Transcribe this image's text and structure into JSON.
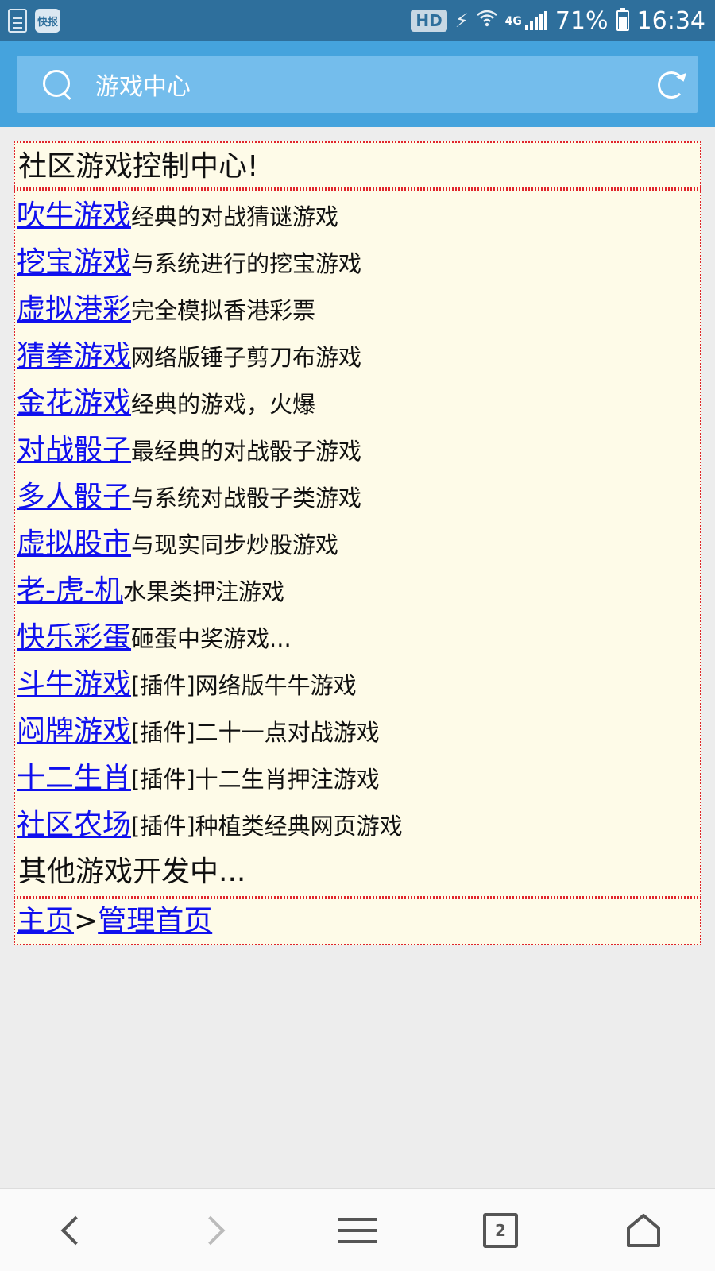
{
  "status_bar": {
    "app_badge": "快报",
    "hd": "HD",
    "network": "4G",
    "battery": "71%",
    "time": "16:34"
  },
  "address_bar": {
    "text": "游戏中心"
  },
  "page": {
    "title": "社区游戏控制中心!",
    "games": [
      {
        "name": "吹牛游戏",
        "desc": "经典的对战猜谜游戏"
      },
      {
        "name": "挖宝游戏",
        "desc": "与系统进行的挖宝游戏"
      },
      {
        "name": "虚拟港彩",
        "desc": "完全模拟香港彩票"
      },
      {
        "name": "猜拳游戏",
        "desc": "网络版锤子剪刀布游戏"
      },
      {
        "name": "金花游戏",
        "desc": "经典的游戏，火爆"
      },
      {
        "name": "对战骰子",
        "desc": "最经典的对战骰子游戏"
      },
      {
        "name": "多人骰子",
        "desc": "与系统对战骰子类游戏"
      },
      {
        "name": "虚拟股市",
        "desc": "与现实同步炒股游戏"
      },
      {
        "name": "老-虎-机",
        "desc": "水果类押注游戏"
      },
      {
        "name": "快乐彩蛋",
        "desc": "砸蛋中奖游戏..."
      },
      {
        "name": "斗牛游戏",
        "desc": "[插件]网络版牛牛游戏"
      },
      {
        "name": "闷牌游戏",
        "desc": "[插件]二十一点对战游戏"
      },
      {
        "name": "十二生肖",
        "desc": "[插件]十二生肖押注游戏"
      },
      {
        "name": "社区农场",
        "desc": "[插件]种植类经典网页游戏"
      }
    ],
    "other_games": "其他游戏开发中...",
    "breadcrumb": {
      "home": "主页",
      "separator": ">",
      "admin": "管理首页"
    }
  },
  "bottom_nav": {
    "tab_count": "2"
  },
  "colors": {
    "status_bar": "#2e6f9c",
    "address_bar": "#45a3dd",
    "address_field": "#74bdec",
    "link": "#1010ee",
    "box_bg": "#fefbe8",
    "box_border": "#e0242a"
  }
}
